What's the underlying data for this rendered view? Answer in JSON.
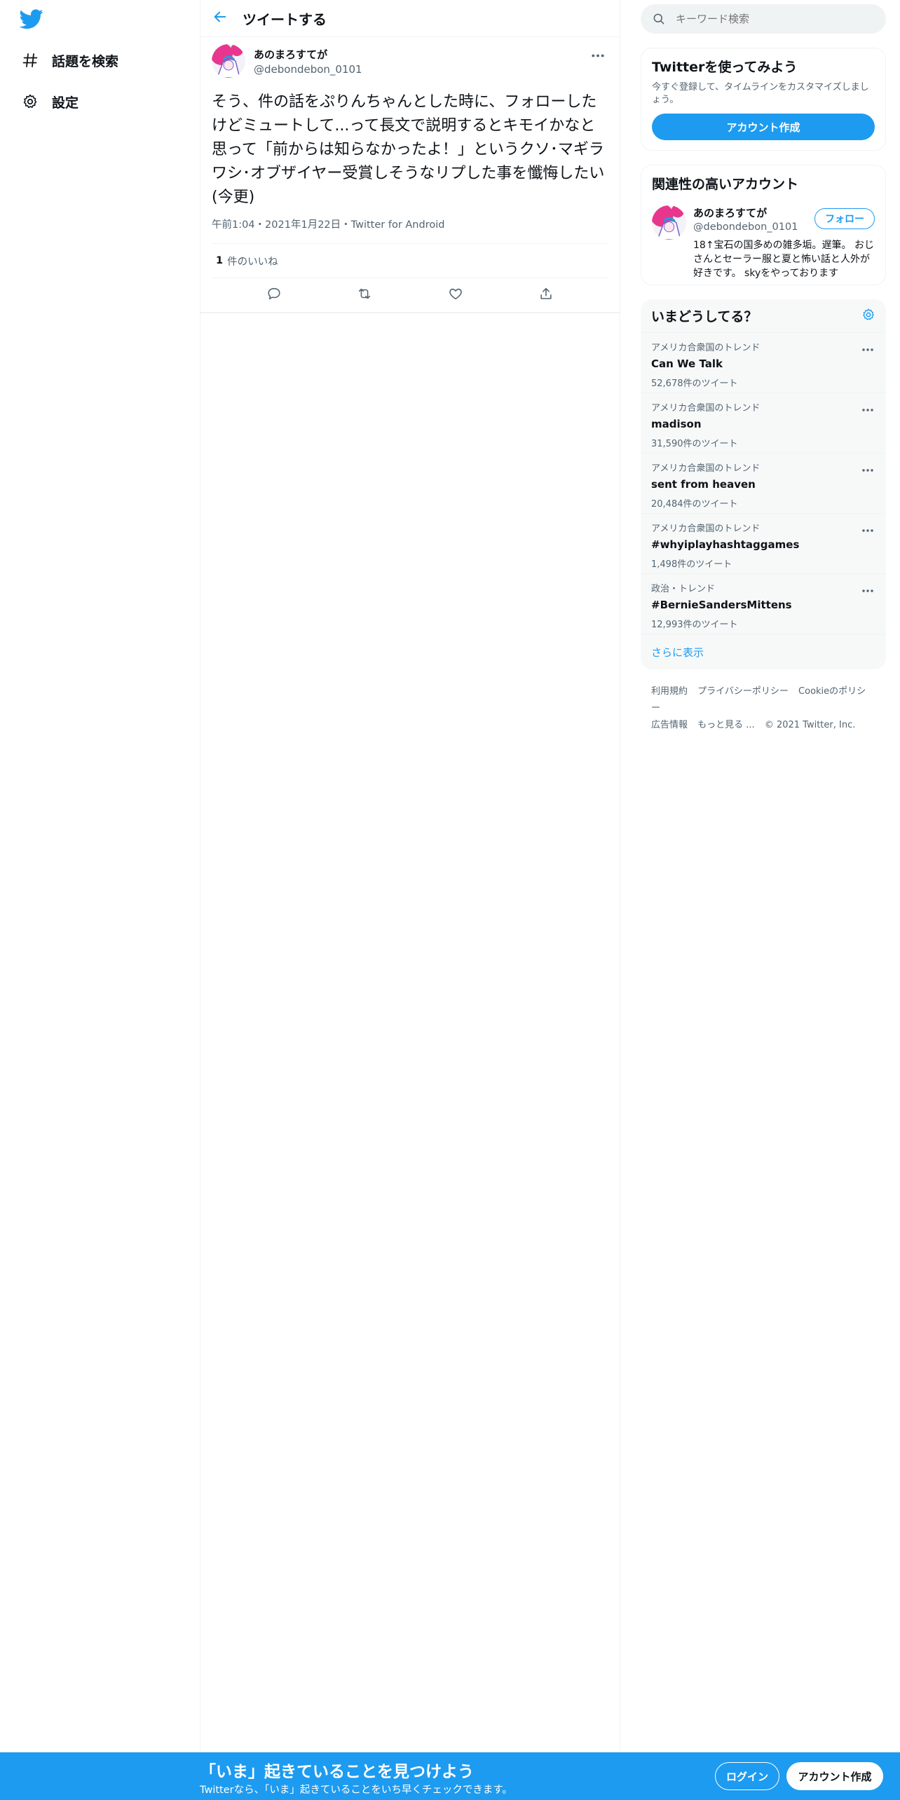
{
  "colors": {
    "accent": "#1d9bf0",
    "text": "#0f1419",
    "muted": "#536471",
    "border": "#eff3f4"
  },
  "nav": {
    "logo_icon": "twitter-bird-icon",
    "items": [
      {
        "label": "話題を検索",
        "icon": "hashtag-icon"
      },
      {
        "label": "設定",
        "icon": "gear-icon"
      }
    ]
  },
  "header": {
    "title": "ツイートする",
    "back_icon": "arrow-left-icon"
  },
  "tweet": {
    "author_name": "あのまろすてが",
    "author_handle": "@debondebon_0101",
    "text": "そう、件の話をぷりんちゃんとした時に、フォローしたけどミュートして...って長文で説明するとキモイかなと思って「前からは知らなかったよ！」というクソ･マギラワシ･オブザイヤー受賞しそうなリプした事を懺悔したい(今更)",
    "meta": "午前1:04・2021年1月22日・Twitter for Android",
    "likes_count": "1",
    "likes_label": "件のいいね",
    "actions": [
      "reply-icon",
      "retweet-icon",
      "like-icon",
      "share-icon"
    ]
  },
  "search": {
    "placeholder": "キーワード検索"
  },
  "signup_card": {
    "title": "Twitterを使ってみよう",
    "subtitle": "今すぐ登録して、タイムラインをカスタマイズしましょう。",
    "button": "アカウント作成"
  },
  "related": {
    "title": "関連性の高いアカウント",
    "user": {
      "name": "あのまろすてが",
      "handle": "@debondebon_0101",
      "bio": "18↑宝石の国多めの雑多垢。遅筆。 おじさんとセーラー服と夏と怖い話と人外が好きです。 skyをやっております",
      "follow": "フォロー"
    }
  },
  "trends": {
    "title": "いまどうしてる？",
    "items": [
      {
        "context": "アメリカ合衆国のトレンド",
        "name": "Can We Talk",
        "count": "52,678件のツイート"
      },
      {
        "context": "アメリカ合衆国のトレンド",
        "name": "madison",
        "count": "31,590件のツイート"
      },
      {
        "context": "アメリカ合衆国のトレンド",
        "name": "sent from heaven",
        "count": "20,484件のツイート"
      },
      {
        "context": "アメリカ合衆国のトレンド",
        "name": "#whyiplayhashtaggames",
        "count": "1,498件のツイート"
      },
      {
        "context": "政治・トレンド",
        "name": "#BernieSandersMittens",
        "count": "12,993件のツイート"
      }
    ],
    "show_more": "さらに表示"
  },
  "footer": {
    "links": [
      "利用規約",
      "プライバシーポリシー",
      "Cookieのポリシー",
      "広告情報",
      "もっと見る ..."
    ],
    "copyright": "© 2021 Twitter, Inc."
  },
  "bottom_bar": {
    "title": "「いま」起きていることを見つけよう",
    "subtitle": "Twitterなら、「いま」起きていることをいち早くチェックできます。",
    "login": "ログイン",
    "signup": "アカウント作成"
  }
}
